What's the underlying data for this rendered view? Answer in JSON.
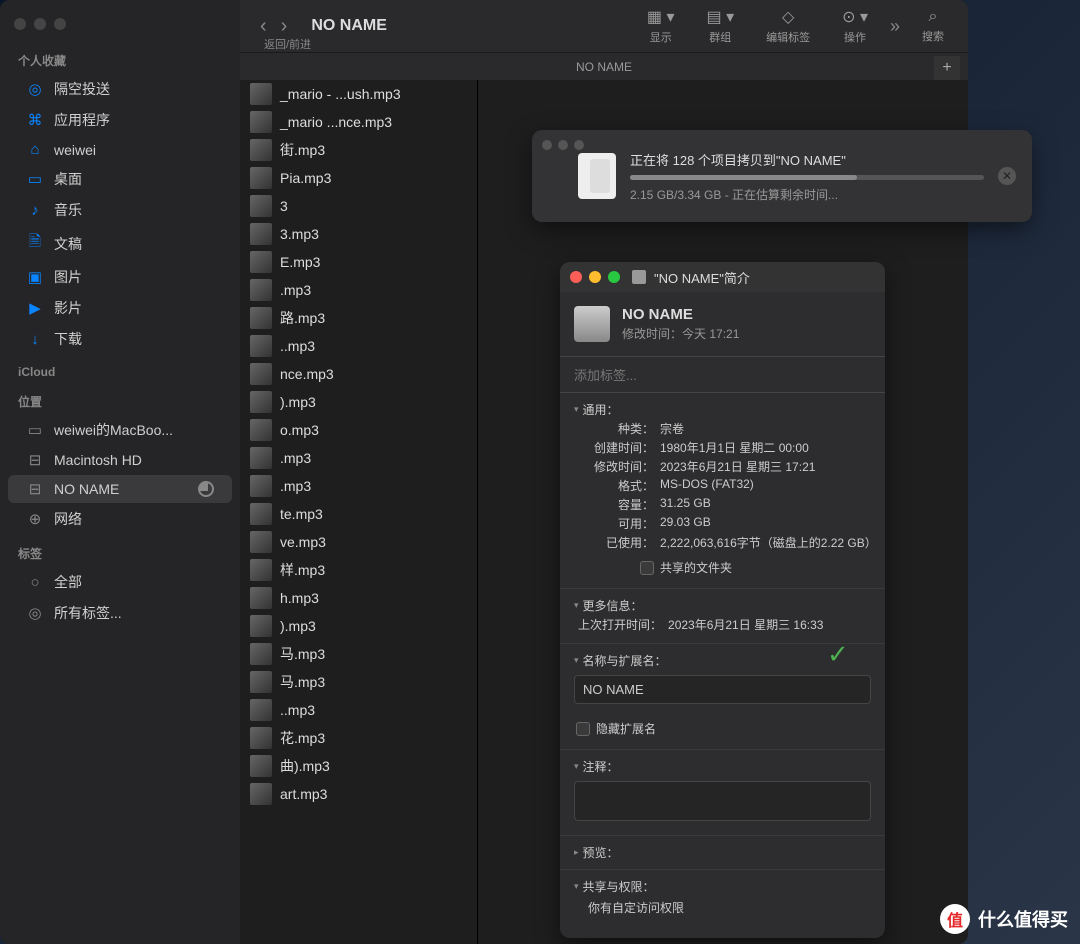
{
  "window": {
    "title": "NO NAME",
    "back_forward_label": "返回/前进",
    "path_bar": "NO NAME"
  },
  "toolbar": {
    "view": {
      "label": "显示"
    },
    "group": {
      "label": "群组"
    },
    "tags": {
      "label": "编辑标签"
    },
    "actions": {
      "label": "操作"
    },
    "search": {
      "label": "搜索"
    }
  },
  "sidebar": {
    "favorites_header": "个人收藏",
    "favorites": [
      {
        "icon": "◎",
        "label": "隔空投送"
      },
      {
        "icon": "⌘",
        "label": "应用程序"
      },
      {
        "icon": "⌂",
        "label": "weiwei"
      },
      {
        "icon": "▭",
        "label": "桌面"
      },
      {
        "icon": "♪",
        "label": "音乐"
      },
      {
        "icon": "🗎",
        "label": "文稿"
      },
      {
        "icon": "▣",
        "label": "图片"
      },
      {
        "icon": "▶",
        "label": "影片"
      },
      {
        "icon": "↓",
        "label": "下载"
      }
    ],
    "icloud_header": "iCloud",
    "locations_header": "位置",
    "locations": [
      {
        "icon": "▭",
        "label": "weiwei的MacBoo..."
      },
      {
        "icon": "⊟",
        "label": "Macintosh HD"
      },
      {
        "icon": "⊟",
        "label": "NO NAME"
      },
      {
        "icon": "⊕",
        "label": "网络"
      }
    ],
    "tags_header": "标签",
    "tags": [
      {
        "icon": "○",
        "label": "全部"
      },
      {
        "icon": "◎",
        "label": "所有标签..."
      }
    ]
  },
  "files": [
    "_mario - ...ush.mp3",
    "_mario ...nce.mp3",
    "街.mp3",
    "Pia.mp3",
    "3",
    "3.mp3",
    "E.mp3",
    ".mp3",
    "路.mp3",
    "..mp3",
    "nce.mp3",
    ").mp3",
    "o.mp3",
    ".mp3",
    ".mp3",
    "te.mp3",
    "ve.mp3",
    "样.mp3",
    "h.mp3",
    ").mp3",
    "马.mp3",
    "马.mp3",
    "..mp3",
    "花.mp3",
    "曲).mp3",
    "art.mp3"
  ],
  "copy": {
    "title": "正在将 128 个项目拷贝到\"NO NAME\"",
    "status": "2.15 GB/3.34 GB - 正在估算剩余时间..."
  },
  "info": {
    "titlebar": "\"NO NAME\"简介",
    "name": "NO NAME",
    "modified_label": "修改时间：",
    "modified_value": "今天 17:21",
    "tags_placeholder": "添加标签...",
    "general_header": "通用：",
    "general": {
      "kind_k": "种类：",
      "kind_v": "宗卷",
      "created_k": "创建时间：",
      "created_v": "1980年1月1日 星期二 00:00",
      "mod_k": "修改时间：",
      "mod_v": "2023年6月21日 星期三 17:21",
      "format_k": "格式：",
      "format_v": "MS-DOS (FAT32)",
      "capacity_k": "容量：",
      "capacity_v": "31.25 GB",
      "avail_k": "可用：",
      "avail_v": "29.03 GB",
      "used_k": "已使用：",
      "used_v": "2,222,063,616字节（磁盘上的2.22 GB）",
      "shared_label": "共享的文件夹"
    },
    "more_header": "更多信息：",
    "more": {
      "opened_k": "上次打开时间：",
      "opened_v": "2023年6月21日 星期三 16:33"
    },
    "name_ext_header": "名称与扩展名：",
    "name_ext": {
      "value": "NO NAME",
      "hide_label": "隐藏扩展名"
    },
    "comments_header": "注释：",
    "preview_header": "预览：",
    "sharing_header": "共享与权限：",
    "sharing_text": "你有自定访问权限"
  },
  "watermark": {
    "badge": "值",
    "text": "什么值得买"
  }
}
